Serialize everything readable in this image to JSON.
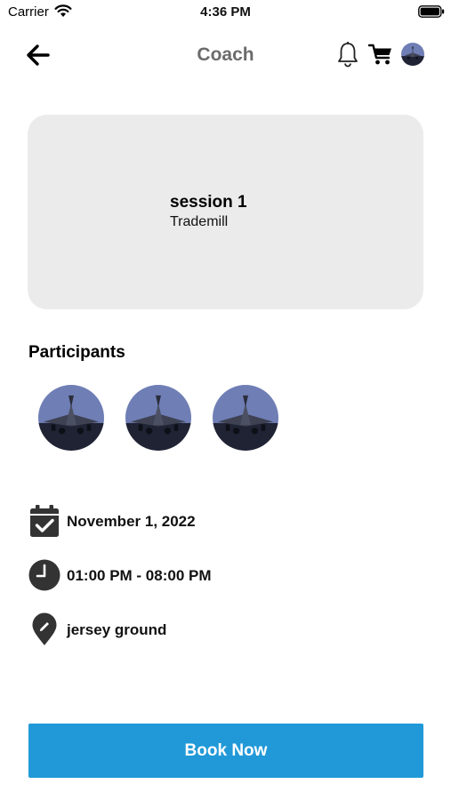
{
  "status_bar": {
    "carrier": "Carrier",
    "time": "4:36 PM"
  },
  "header": {
    "title": "Coach"
  },
  "session": {
    "title": "session 1",
    "subtitle": "Trademill"
  },
  "participants": {
    "heading": "Participants",
    "count": 3
  },
  "details": {
    "date": "November 1, 2022",
    "time": "01:00 PM - 08:00 PM",
    "location": "jersey ground"
  },
  "actions": {
    "book_label": "Book Now"
  },
  "colors": {
    "accent": "#2199d8",
    "card_bg": "#ecebec",
    "icon_dark": "#333333"
  },
  "icons": [
    "back-arrow-icon",
    "bell-icon",
    "cart-icon",
    "calendar-check-icon",
    "clock-icon",
    "location-pin-icon"
  ]
}
